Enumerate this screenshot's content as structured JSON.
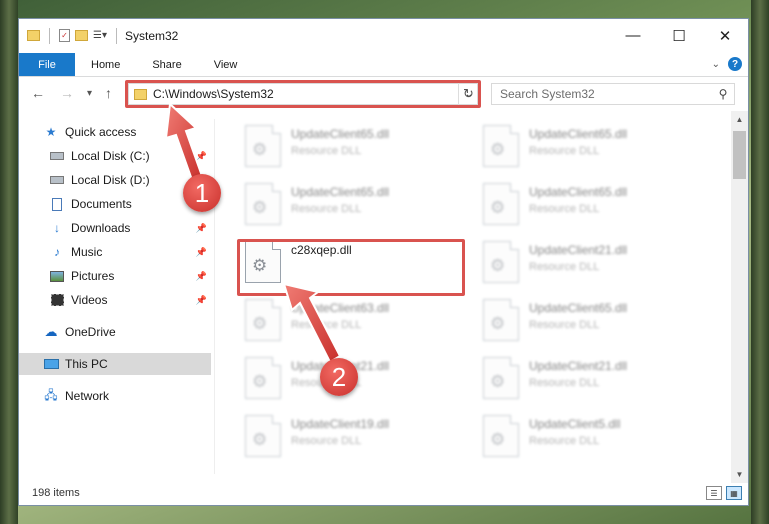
{
  "window": {
    "title": "System32",
    "controls": {
      "minimize": "—",
      "maximize": "☐",
      "close": "✕"
    }
  },
  "ribbon": {
    "tabs": [
      {
        "label": "File",
        "active": true
      },
      {
        "label": "Home"
      },
      {
        "label": "Share"
      },
      {
        "label": "View"
      }
    ],
    "help": "?"
  },
  "navigation": {
    "back": "←",
    "forward": "→",
    "recent": "▾",
    "up": "↑",
    "address": "C:\\Windows\\System32",
    "refresh": "↻",
    "search_placeholder": "Search System32"
  },
  "sidebar": {
    "items": [
      {
        "label": "Quick access",
        "icon": "star-icon",
        "pinned": false
      },
      {
        "label": "Local Disk (C:)",
        "icon": "drive-icon",
        "pinned": true
      },
      {
        "label": "Local Disk (D:)",
        "icon": "drive-icon",
        "pinned": false
      },
      {
        "label": "Documents",
        "icon": "documents-icon",
        "pinned": true
      },
      {
        "label": "Downloads",
        "icon": "downloads-icon",
        "pinned": true
      },
      {
        "label": "Music",
        "icon": "music-icon",
        "pinned": true
      },
      {
        "label": "Pictures",
        "icon": "pictures-icon",
        "pinned": true
      },
      {
        "label": "Videos",
        "icon": "videos-icon",
        "pinned": true
      },
      {
        "label": "OneDrive",
        "icon": "onedrive-icon",
        "pinned": false
      },
      {
        "label": "This PC",
        "icon": "this-pc-icon",
        "pinned": false,
        "selected": true
      },
      {
        "label": "Network",
        "icon": "network-icon",
        "pinned": false
      }
    ]
  },
  "files": [
    {
      "name": "UpdateClient65.dll",
      "type": "Resource DLL"
    },
    {
      "name": "UpdateClient65.dll",
      "type": "Resource DLL"
    },
    {
      "name": "UpdateClient65.dll",
      "type": "Resource DLL"
    },
    {
      "name": "UpdateClient65.dll",
      "type": "Resource DLL"
    },
    {
      "name": "c28xqep.dll",
      "type": ""
    },
    {
      "name": "UpdateClient21.dll",
      "type": "Resource DLL"
    },
    {
      "name": "UpdateClient63.dll",
      "type": "Resource DLL"
    },
    {
      "name": "UpdateClient65.dll",
      "type": "Resource DLL"
    },
    {
      "name": "UpdateClient21.dll",
      "type": "Resource DLL"
    },
    {
      "name": "UpdateClient21.dll",
      "type": "Resource DLL"
    },
    {
      "name": "UpdateClient19.dll",
      "type": "Resource DLL"
    },
    {
      "name": "UpdateClient5.dll",
      "type": "Resource DLL"
    }
  ],
  "status": {
    "item_count": "198 items"
  },
  "callouts": [
    "1",
    "2"
  ],
  "colors": {
    "accent": "#1979ca",
    "highlight": "#d9534f"
  }
}
